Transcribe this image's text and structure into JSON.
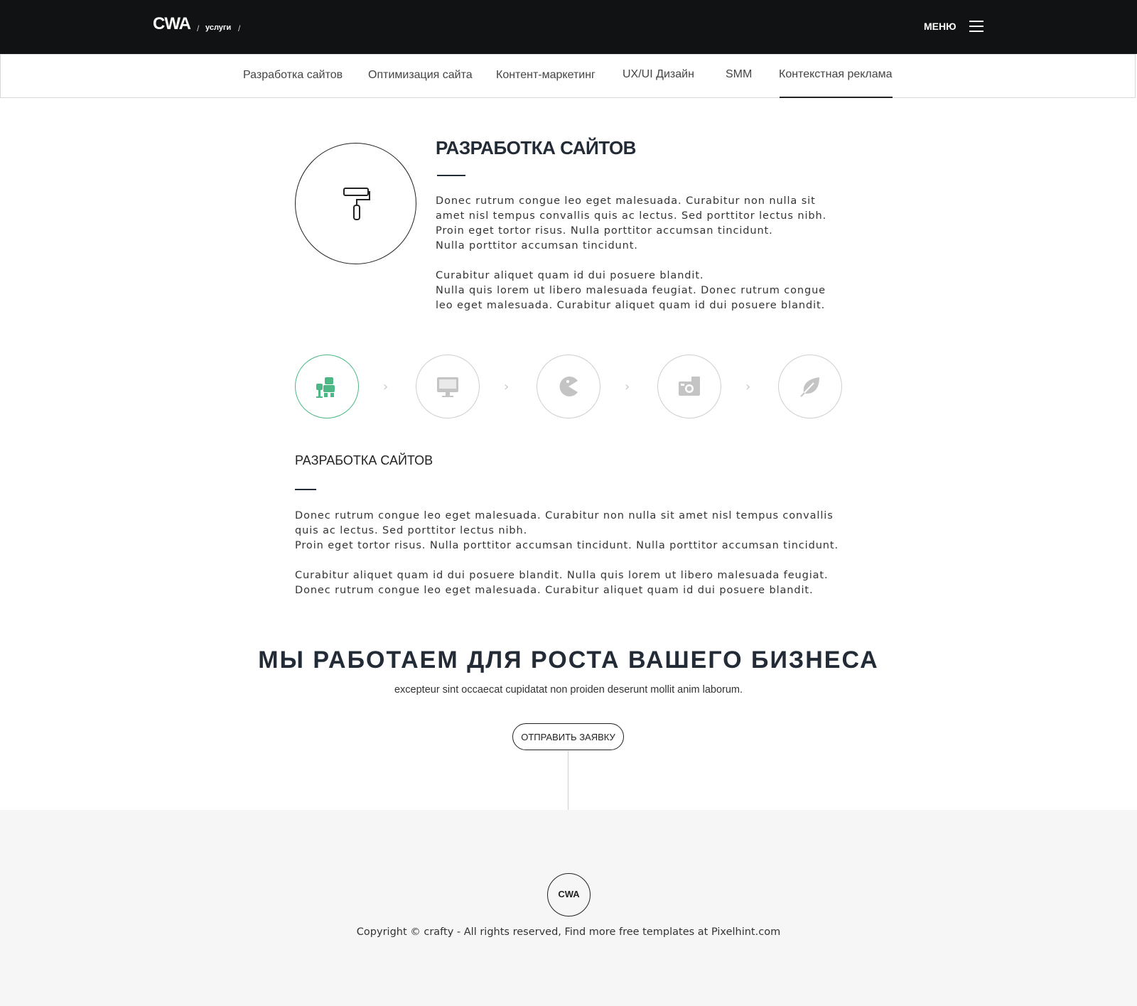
{
  "header": {
    "logo": "CWA",
    "breadcrumb_sep": "/",
    "breadcrumb_item": "услуги",
    "menu_label": "МЕНЮ"
  },
  "tabs": [
    {
      "label": "Разработка сайтов"
    },
    {
      "label": "Оптимизация сайта"
    },
    {
      "label": "Контент-маркетинг"
    },
    {
      "label": "UX/UI Дизайн"
    },
    {
      "label": "SMM"
    },
    {
      "label": "Контекстная реклама",
      "active": true
    }
  ],
  "section1": {
    "title": "РАЗРАБОТКА САЙТОВ",
    "icon": "paint-roller-icon",
    "lines": [
      "Donec rutrum congue leo eget malesuada. Curabitur non nulla sit",
      "amet nisl tempus convallis quis ac lectus. Sed porttitor lectus nibh.",
      "Proin eget tortor risus. Nulla porttitor accumsan tincidunt.",
      "Nulla porttitor accumsan tincidunt.",
      "Curabitur aliquet quam id dui posuere blandit.",
      "Nulla quis lorem ut libero malesuada feugiat. Donec rutrum congue",
      "leo eget malesuada. Curabitur aliquet quam id dui posuere blandit."
    ]
  },
  "steps": [
    {
      "icon": "robot-icon",
      "active": true
    },
    {
      "icon": "monitor-icon"
    },
    {
      "icon": "pacman-icon"
    },
    {
      "icon": "camera-icon"
    },
    {
      "icon": "leaf-icon"
    }
  ],
  "chevron": "›",
  "section2": {
    "title": "РАЗРАБОТКА САЙТОВ",
    "lines": [
      "Donec rutrum congue leo eget malesuada. Curabitur non nulla sit amet nisl tempus convallis",
      "quis ac lectus. Sed porttitor lectus nibh.",
      "Proin eget tortor risus. Nulla porttitor accumsan tincidunt. Nulla porttitor accumsan tincidunt.",
      "Curabitur aliquet quam id dui posuere blandit. Nulla quis lorem ut libero malesuada feugiat.",
      "Donec rutrum congue leo eget malesuada. Curabitur aliquet quam id dui posuere blandit."
    ]
  },
  "cta": {
    "title": "МЫ РАБОТАЕМ ДЛЯ РОСТА ВАШЕГО БИЗНЕСА",
    "subtitle": "excepteur sint occaecat cupidatat non proiden deserunt mollit anim laborum.",
    "button": "ОТПРАВИТЬ ЗАЯВКУ"
  },
  "footer": {
    "logo": "CWA",
    "copyright": "Copyright © crafty - All rights reserved, Find more free templates at Pixelhint.com"
  },
  "colors": {
    "header_bg": "#111213",
    "accent_green": "#4db885",
    "text_dark": "#222b36",
    "footer_bg": "#f6f6f6"
  }
}
